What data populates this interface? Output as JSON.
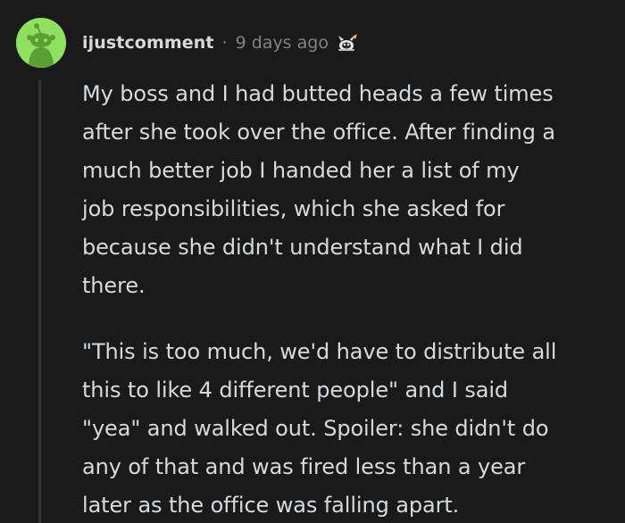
{
  "comment": {
    "username": "ijustcomment",
    "separator": "·",
    "timestamp": "9 days ago",
    "avatar_icon": "reddit-snoo-avatar-icon",
    "award_icon": "award-icon",
    "avatar_color": "#8fe05f",
    "background_color": "#1a1a1b",
    "paragraphs": [
      "My boss and I had butted heads a few times\nafter she took over the office. After finding a\nmuch better job I handed her a list of my\njob responsibilities, which she asked for\nbecause she didn't understand what I did\nthere.",
      "\"This is too much, we'd have to distribute all\nthis to like 4 different people\" and I said\n\"yea\" and walked out. Spoiler: she didn't do\nany of that and was fired less than a year\nlater as the office was falling apart."
    ]
  }
}
